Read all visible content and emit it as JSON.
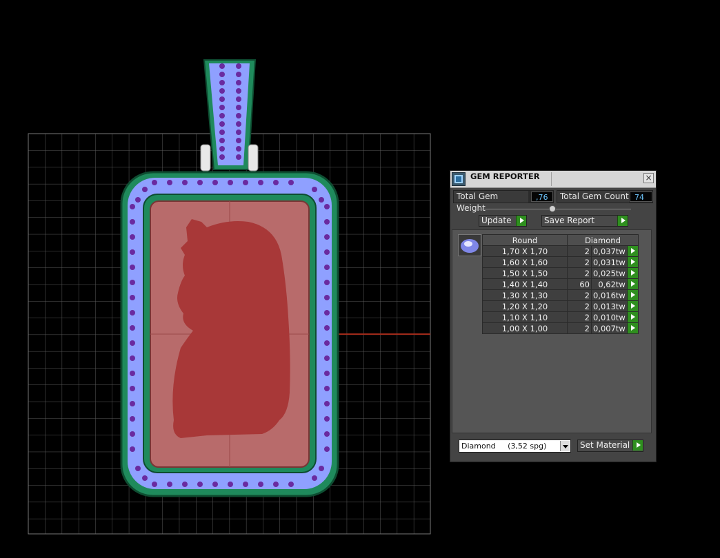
{
  "gem_reporter": {
    "title": "GEM REPORTER",
    "close_glyph": "×",
    "total_weight_label": "Total Gem Weight",
    "total_weight_value": ",76",
    "total_count_label": "Total Gem Count",
    "total_count_value": "74",
    "update_label": "Update",
    "save_report_label": "Save Report",
    "table": {
      "col_shape": "Round",
      "col_material": "Diamond",
      "rows": [
        {
          "size": "1,70 X 1,70",
          "count": "2",
          "weight": "0,037tw"
        },
        {
          "size": "1,60 X 1,60",
          "count": "2",
          "weight": "0,031tw"
        },
        {
          "size": "1,50 X 1,50",
          "count": "2",
          "weight": "0,025tw"
        },
        {
          "size": "1,40 X 1,40",
          "count": "60",
          "weight": "0,62tw"
        },
        {
          "size": "1,30 X 1,30",
          "count": "2",
          "weight": "0,016tw"
        },
        {
          "size": "1,20 X 1,20",
          "count": "2",
          "weight": "0,013tw"
        },
        {
          "size": "1,10 X 1,10",
          "count": "2",
          "weight": "0,010tw"
        },
        {
          "size": "1,00 X 1,00",
          "count": "2",
          "weight": "0,007tw"
        }
      ]
    },
    "material_select_value": "Diamond     (3,52 spg)",
    "set_material_label": "Set Material"
  },
  "icons": {
    "title_icon": "gem-reporter-app-icon",
    "thumb_icon": "round-diamond-icon",
    "close_icon": "close-icon",
    "go_icon": "green-arrow-icon",
    "dropdown_icon": "chevron-down-icon"
  },
  "colors": {
    "background": "#000000",
    "grid": "#6e6e6e",
    "gem_blue": "#8fa0ff",
    "gem_purple": "#6a2aa0",
    "metal_green": "#1f8a5c",
    "plate": "#b86b6b",
    "silhouette": "#a83838",
    "accent_green": "#2f8f1f",
    "value_blue": "#6fc7ff"
  }
}
